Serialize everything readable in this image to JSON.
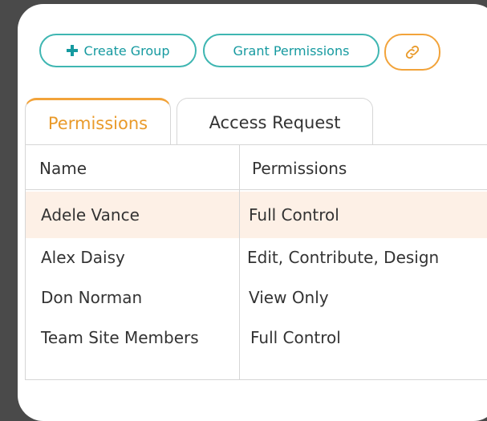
{
  "toolbar": {
    "create_group_label": "Create Group",
    "grant_permissions_label": "Grant Permissions",
    "plus_icon": "plus-icon",
    "link_icon": "link-icon"
  },
  "tabs": [
    {
      "label": "Permissions",
      "active": true
    },
    {
      "label": "Access Request",
      "active": false
    }
  ],
  "table": {
    "headers": [
      "Name",
      "Permissions"
    ],
    "rows": [
      {
        "name": "Adele Vance",
        "permissions": "Full Control",
        "highlighted": true
      },
      {
        "name": "Alex Daisy",
        "permissions": "Edit, Contribute, Design",
        "highlighted": false
      },
      {
        "name": "Don Norman",
        "permissions": "View Only",
        "highlighted": false
      },
      {
        "name": "Team Site Members",
        "permissions": "Full Control",
        "highlighted": false
      }
    ]
  },
  "colors": {
    "accent_teal": "#3fb6b2",
    "accent_orange": "#f2a33a",
    "row_highlight": "#fdf0e6",
    "background": "#4a4a4a"
  }
}
